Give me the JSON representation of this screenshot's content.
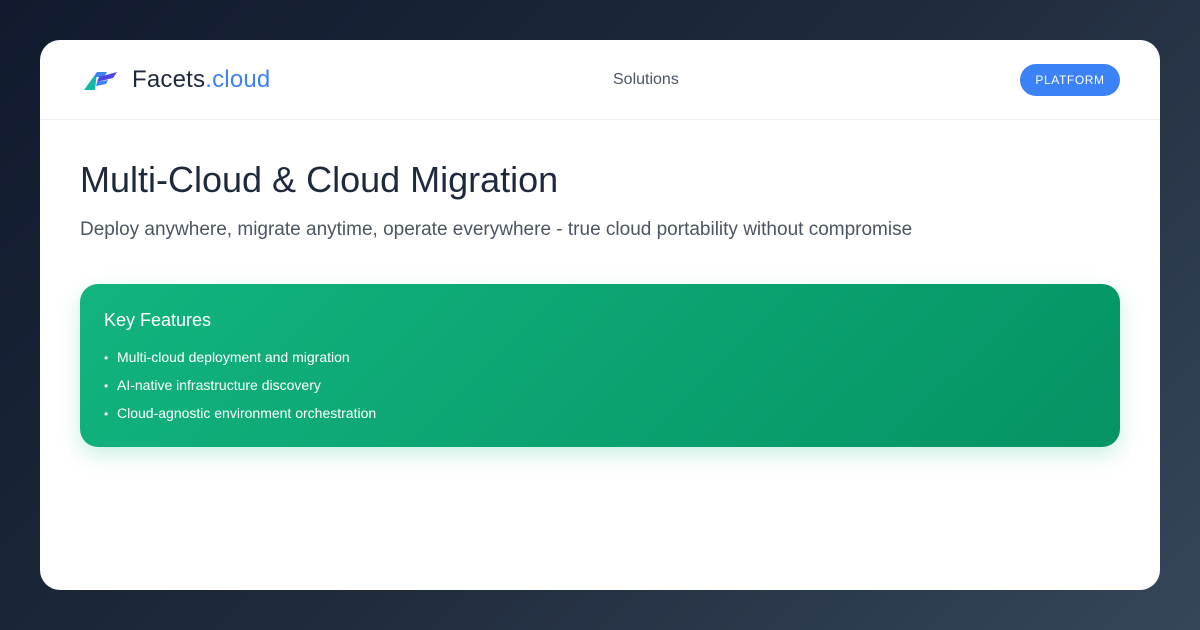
{
  "header": {
    "brand_name": "Facets",
    "brand_suffix": ".cloud",
    "logo_icon": "facets-logo-icon",
    "nav": [
      {
        "label": "Solutions"
      }
    ],
    "platform_button": "PLATFORM"
  },
  "hero": {
    "title": "Multi-Cloud & Cloud Migration",
    "subtitle": "Deploy anywhere, migrate anytime, operate everywhere - true cloud portability without compromise"
  },
  "features": {
    "title": "Key Features",
    "bullet": "•",
    "items": [
      "Multi-cloud deployment and migration",
      "AI-native infrastructure discovery",
      "Cloud-agnostic environment orchestration"
    ]
  },
  "colors": {
    "accent": "#3b82f6",
    "features_gradient_start": "#12b47f",
    "features_gradient_end": "#059364",
    "logo_teal": "#14b8a6",
    "logo_blue": "#3b82f6",
    "logo_indigo": "#4f46e5",
    "title_text": "#1e293b"
  }
}
